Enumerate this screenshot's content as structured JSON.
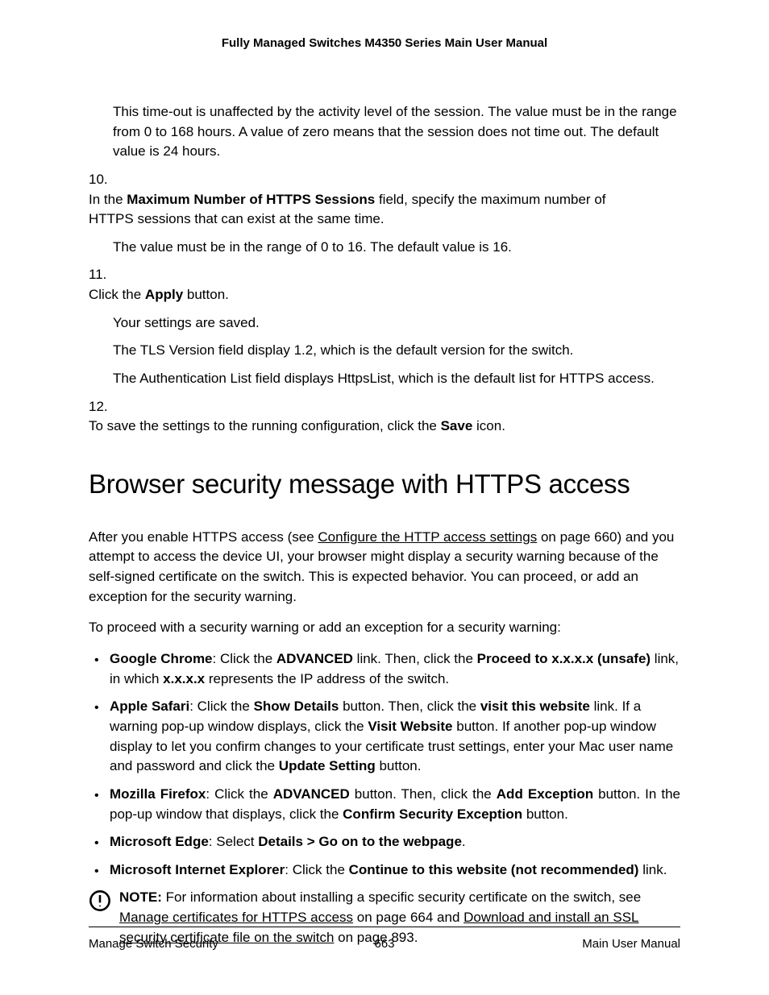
{
  "header": {
    "title": "Fully Managed Switches M4350 Series Main User Manual"
  },
  "body": {
    "p1": "This time-out is unaffected by the activity level of the session. The value must be in the range from 0 to 168 hours. A value of zero means that the session does not time out. The default value is 24 hours.",
    "step10_num": "10.",
    "step10_a": "In the ",
    "step10_b": "Maximum Number of HTTPS Sessions",
    "step10_c": " field, specify the maximum number of HTTPS sessions that can exist at the same time.",
    "step10_p2": "The value must be in the range of 0 to 16. The default value is 16.",
    "step11_num": "11.",
    "step11_a": "Click the ",
    "step11_b": "Apply",
    "step11_c": " button.",
    "step11_p2": "Your settings are saved.",
    "step11_p3": "The TLS Version field display 1.2, which is the default version for the switch.",
    "step11_p4": "The Authentication List field displays HttpsList, which is the default list for HTTPS access.",
    "step12_num": "12.",
    "step12_a": "To save the settings to the running configuration, click the ",
    "step12_b": "Save",
    "step12_c": " icon.",
    "h2": "Browser security message with HTTPS access",
    "intro_a": "After you enable HTTPS access (see ",
    "intro_link": "Configure the HTTP access settings",
    "intro_b": " on page 660) and you attempt to access the device UI, your browser might display a security warning because of the self-signed certificate on the switch. This is expected behavior. You can proceed, or add an exception for the security warning.",
    "intro2": "To proceed with a security warning or add an exception for a security warning:",
    "chrome_label": "Google Chrome",
    "chrome_a": ": Click the ",
    "chrome_b": "ADVANCED",
    "chrome_c": " link. Then, click the ",
    "chrome_d": "Proceed to x.x.x.x (unsafe)",
    "chrome_e": " link, in which ",
    "chrome_f": "x.x.x.x",
    "chrome_g": " represents the IP address of the switch.",
    "safari_label": "Apple Safari",
    "safari_a": ": Click the ",
    "safari_b": "Show Details",
    "safari_c": " button. Then, click the ",
    "safari_d": "visit this website",
    "safari_e": " link. If a warning pop-up window displays, click the ",
    "safari_f": "Visit Website",
    "safari_g": " button. If another pop-up window display to let you confirm changes to your certificate trust settings, enter your Mac user name and password and click the ",
    "safari_h": "Update Setting",
    "safari_i": " button.",
    "firefox_label": "Mozilla Firefox",
    "firefox_a": ": Click the ",
    "firefox_b": "ADVANCED",
    "firefox_c": " button. Then, click the ",
    "firefox_d": "Add Exception",
    "firefox_e": " button. In the pop-up window that displays, click the ",
    "firefox_f": "Confirm Security Exception",
    "firefox_g": " button.",
    "edge_label": "Microsoft Edge",
    "edge_a": ": Select ",
    "edge_b": "Details > Go on to the webpage",
    "edge_c": ".",
    "ie_label": "Microsoft Internet Explorer",
    "ie_a": ": Click the ",
    "ie_b": "Continue to this website (not recommended)",
    "ie_c": " link.",
    "note_label": "NOTE:",
    "note_a": "  For information about installing a specific security certificate on the switch, see ",
    "note_link1": "Manage certificates for HTTPS access",
    "note_b": " on page 664 and ",
    "note_link2": "Download and install an SSL security certificate file on the switch",
    "note_c": " on page 893."
  },
  "footer": {
    "left": "Manage Switch Security",
    "center": "663",
    "right": "Main User Manual"
  }
}
